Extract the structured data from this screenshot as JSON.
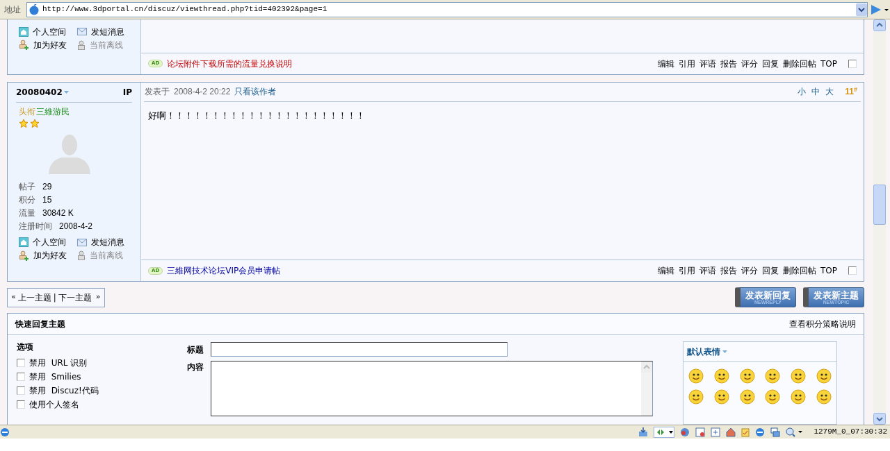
{
  "address_bar": {
    "label": "地址",
    "url": "http://www.3dportal.cn/discuz/viewthread.php?tid=402392&page=1"
  },
  "posts": [
    {
      "user_links": [
        {
          "kind": "home",
          "label": "个人空间"
        },
        {
          "kind": "message",
          "label": "发短消息"
        },
        {
          "kind": "friend",
          "label": "加为好友"
        },
        {
          "kind": "status",
          "label": "当前离线",
          "online": false
        }
      ],
      "ad": {
        "badge": "AD",
        "text": "论坛附件下载所需的流量兑换说明",
        "kind": "notice"
      },
      "actions": [
        "编辑",
        "引用",
        "评语",
        "报告",
        "评分",
        "回复",
        "删除回帖",
        "TOP"
      ],
      "checked": false
    },
    {
      "username": "20080402",
      "ip": "IP",
      "title_label": "头衔",
      "title": "三維游民",
      "rank_icons": [
        {
          "kind": "star"
        },
        {
          "kind": "star"
        }
      ],
      "stats": [
        {
          "label": "帖子",
          "value": "29"
        },
        {
          "label": "积分",
          "value": "15"
        },
        {
          "label": "流量",
          "value": "30842 K"
        },
        {
          "label": "注册时间",
          "value": "2008-4-2"
        }
      ],
      "user_links": [
        {
          "kind": "home",
          "label": "个人空间"
        },
        {
          "kind": "message",
          "label": "发短消息"
        },
        {
          "kind": "friend",
          "label": "加为好友"
        },
        {
          "kind": "status",
          "label": "当前离线",
          "online": false
        }
      ],
      "posted_label": "发表于",
      "posted_at": "2008-4-2 20:22",
      "author_only": "只看该作者",
      "font_sizes": [
        "小",
        "中",
        "大"
      ],
      "floor": "11$^{#}$",
      "content": "好啊！！！！！！！！！！！！！！！！！！！！！！",
      "ad": {
        "badge": "AD",
        "text": "三維网技术论坛VIP会员申请帖",
        "kind": "link"
      },
      "actions": [
        "编辑",
        "引用",
        "评语",
        "报告",
        "评分",
        "回复",
        "删除回帖",
        "TOP"
      ],
      "checked": false
    }
  ],
  "nav": {
    "prev_arrow": "«",
    "prev": "上一主题",
    "separator": "|",
    "next": "下一主题",
    "next_arrow": "»"
  },
  "buttons": [
    {
      "label": "发表新回复",
      "sub": "NEWREPLY"
    },
    {
      "label": "发表新主题",
      "sub": "NEWTOPIC"
    }
  ],
  "quick_reply": {
    "title": "快速回复主题",
    "help_link": "查看积分策略说明",
    "options_heading": "选项",
    "options": [
      {
        "label": "禁用  URL 识别",
        "checked": false
      },
      {
        "label": "禁用  Smilies",
        "checked": false
      },
      {
        "label": "禁用  Discuz!代码",
        "checked": false
      },
      {
        "label": "使用个人签名",
        "checked": false
      }
    ],
    "subject_label": "标题",
    "content_label": "内容",
    "smilies_heading": "默认表情"
  },
  "status_bar": {
    "text": "1279M_0_07:30:32"
  }
}
